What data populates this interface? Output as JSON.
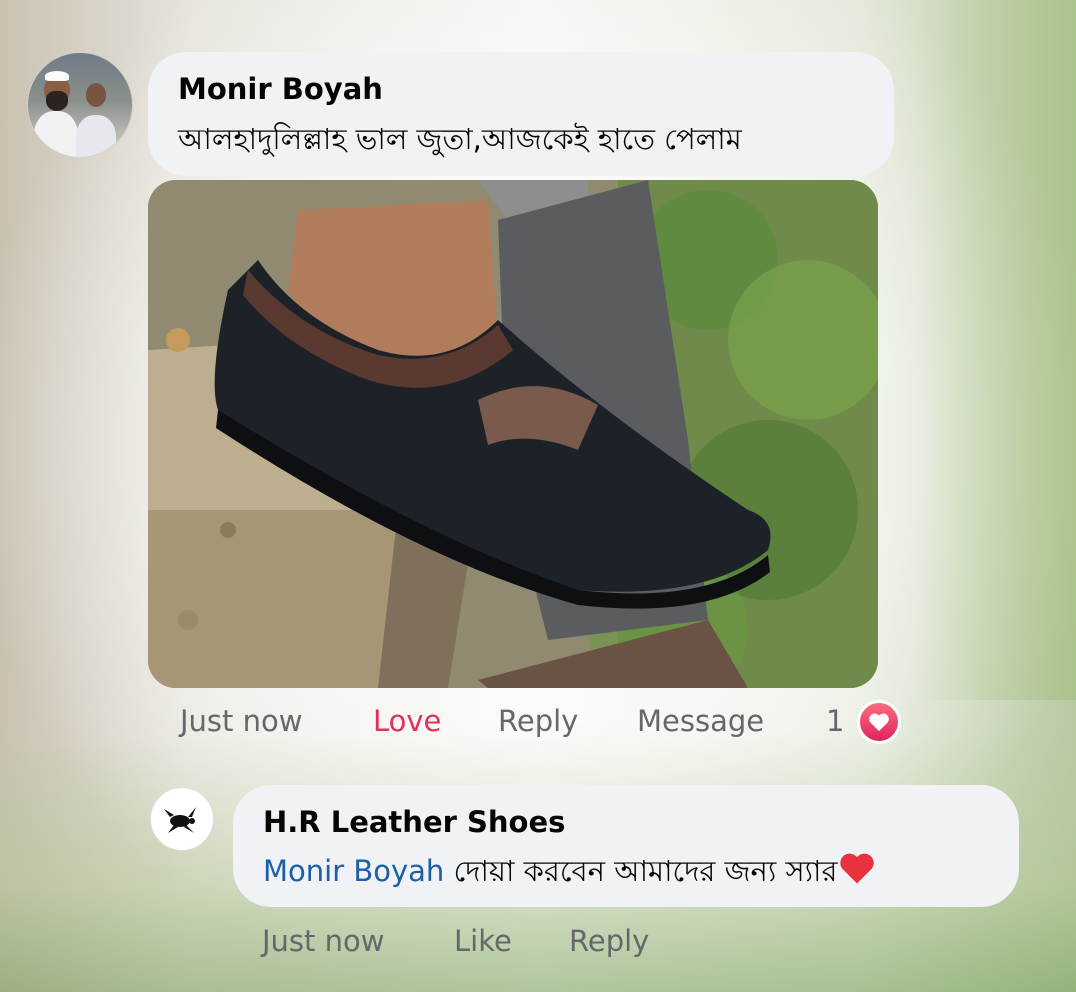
{
  "comment1": {
    "author": "Monir Boyah",
    "text": "আলহাদুলিল্লাহ ভাল জুতা,আজকেই হাতে পেলাম",
    "photo_description_icon": "shoe-photo",
    "meta": {
      "time": "Just now",
      "love": "Love",
      "reply": "Reply",
      "message": "Message",
      "reaction_count": "1",
      "reaction_icon": "heart-reaction-icon"
    }
  },
  "comment2": {
    "author": "H.R Leather Shoes",
    "mention": "Monir Boyah",
    "text": " দোয়া করবেন আমাদের জন্য স্যার",
    "meta": {
      "time": "Just now",
      "like": "Like",
      "reply": "Reply"
    }
  },
  "colors": {
    "bubble": "#f0f2f5",
    "love": "#e0325a",
    "mention": "#1b5fa6",
    "meta": "#65676b"
  }
}
